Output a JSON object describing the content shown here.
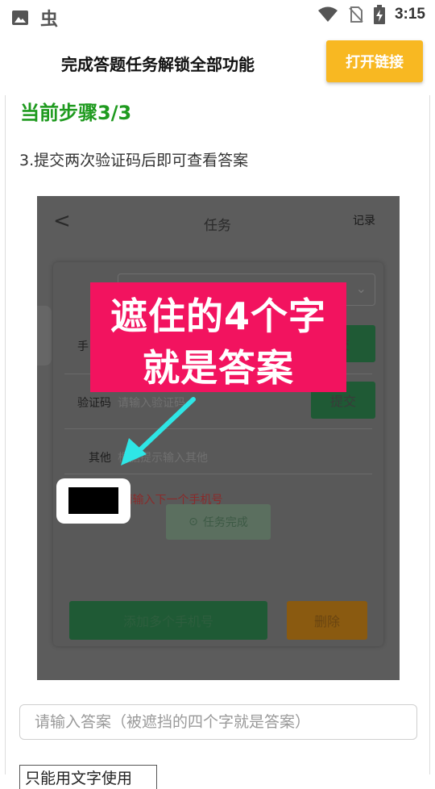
{
  "status_bar": {
    "time": "3:15",
    "left_icons": [
      "image-icon",
      "bug-app-icon"
    ],
    "bug_glyph": "虫",
    "right_icons": [
      "wifi-icon",
      "no-sim-icon",
      "battery-charging-icon"
    ]
  },
  "header": {
    "title": "完成答题任务解锁全部功能",
    "open_link_label": "打开链接",
    "accent_color": "#f8b822"
  },
  "step": {
    "title": "当前步骤3/3",
    "title_color": "#1e9a1e",
    "description": "3.提交两次验证码后即可查看答案"
  },
  "screenshot": {
    "back_glyph": "<",
    "title": "任务",
    "record": "记录",
    "phone_label_partial": "手",
    "code_label": "验证码",
    "code_placeholder": "请输入验证码",
    "submit_label_1": "交",
    "submit_label_2": "提交",
    "other_label": "其他",
    "other_placeholder": "根据提示输入其他",
    "hint_text": ",请输入下一个手机号",
    "complete_label": "任务完成",
    "add_phones_label": "添加多个手机号",
    "delete_label": "删除",
    "overlay_line1": "遮住的4个字",
    "overlay_line2": "就是答案",
    "overlay_color": "#f2135f",
    "arrow_color": "#2ee6e6"
  },
  "answer": {
    "placeholder": "请输入答案（被遮挡的四个字就是答案）"
  },
  "bottom_button": {
    "label": "只能用文字使用"
  }
}
